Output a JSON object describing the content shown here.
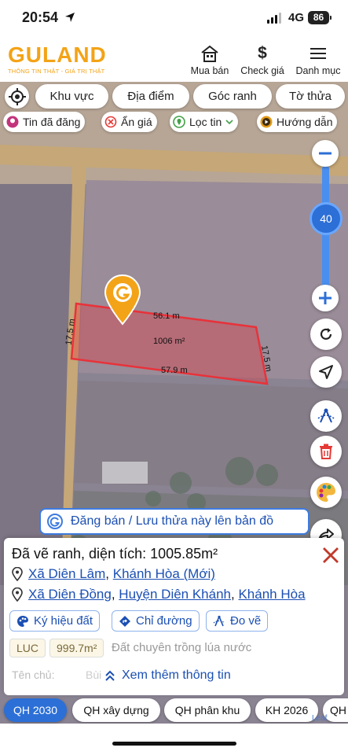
{
  "status_bar": {
    "time": "20:54",
    "network": "4G",
    "battery": "86"
  },
  "header": {
    "logo_text": "GULAND",
    "logo_tagline": "THÔNG TIN THẬT - GIÁ TRỊ THẬT",
    "buttons": [
      {
        "label": "Mua bán",
        "icon": "house-icon"
      },
      {
        "label": "Check giá",
        "icon": "dollar-icon"
      },
      {
        "label": "Danh mục",
        "icon": "menu-icon"
      }
    ]
  },
  "filters": {
    "row1": [
      "Khu vực",
      "Địa điểm",
      "Góc ranh",
      "Tờ thửa"
    ],
    "row2": [
      "Tin đã đăng",
      "Ẩn giá",
      "Lọc tin",
      "Hướng dẫn"
    ]
  },
  "map": {
    "zoom_level": "40",
    "plot": {
      "area_label": "1006 m²",
      "edge_top": "56.1 m",
      "edge_bottom": "57.9 m",
      "edge_left": "17.5 m",
      "edge_right": "17.5 m"
    },
    "post_banner": "Đăng bán / Lưu thửa này lên bản đồ",
    "attribution": "Leaf"
  },
  "panel": {
    "title": "Đã vẽ ranh, diện tích: 1005.85m²",
    "address_new": {
      "commune": "Xã Diên Lâm",
      "province": "Khánh Hòa (Mới)"
    },
    "address_old": {
      "commune": "Xã Diên Đồng",
      "district": "Huyện Diên Khánh",
      "province": "Khánh Hòa"
    },
    "tools": [
      "Ký hiệu đất",
      "Chỉ đường",
      "Đo vẽ"
    ],
    "land_code": "LUC",
    "land_area": "999.7m²",
    "land_desc": "Đất chuyên trồng lúa nước",
    "owner_label": "Tên chủ:",
    "owner_value": "Bùi T. Thả...",
    "more_info": "Xem thêm thông tin"
  },
  "plan_tabs": [
    "QH 2030",
    "QH xây dựng",
    "QH phân khu",
    "KH 2026",
    "QH"
  ],
  "colors": {
    "accent": "#2c6fd6",
    "brand": "#f3a317",
    "plot": "#e8323a"
  }
}
